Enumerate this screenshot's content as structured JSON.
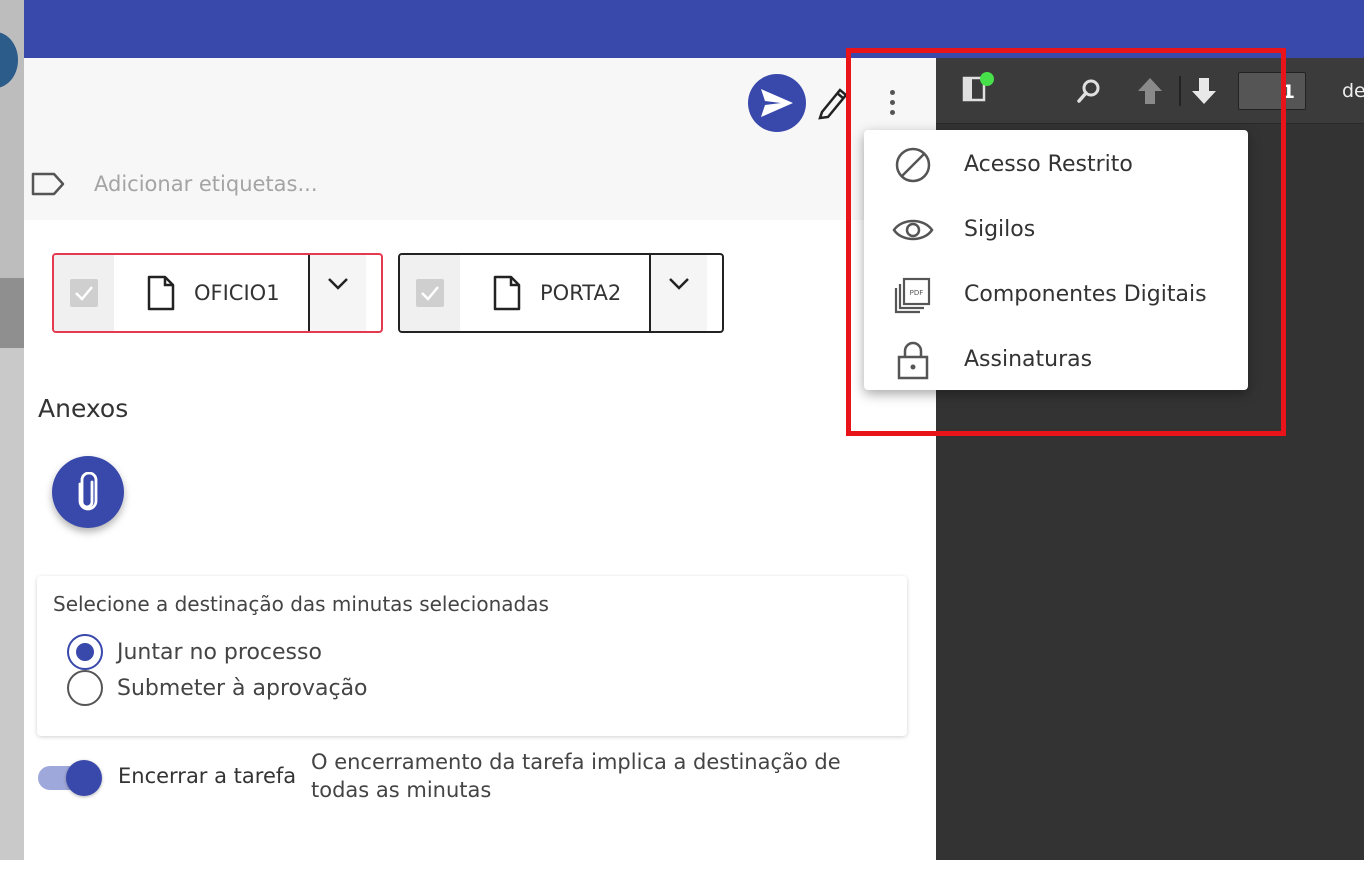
{
  "header": {
    "tags_placeholder": "Adicionar etiquetas..."
  },
  "documents": [
    {
      "name": "OFICIO1",
      "selected": true
    },
    {
      "name": "PORTA2",
      "selected": false
    }
  ],
  "anexos": {
    "title": "Anexos"
  },
  "destination": {
    "title": "Selecione a destinação das minutas selecionadas",
    "options": [
      {
        "label": "Juntar no processo",
        "checked": true
      },
      {
        "label": "Submeter à aprovação",
        "checked": false
      }
    ]
  },
  "close_task": {
    "label": "Encerrar a tarefa",
    "note": "O encerramento da tarefa implica a destinação de todas as minutas",
    "enabled": true
  },
  "pdf_viewer": {
    "page_number": "1",
    "page_of": "de"
  },
  "menu": {
    "items": [
      {
        "label": "Acesso Restrito",
        "icon": "block-icon"
      },
      {
        "label": "Sigilos",
        "icon": "eye-icon"
      },
      {
        "label": "Componentes Digitais",
        "icon": "pdf-icon"
      },
      {
        "label": "Assinaturas",
        "icon": "lock-icon"
      }
    ]
  },
  "colors": {
    "primary": "#3949ab",
    "highlight": "#e8141a",
    "pdf_background": "#333333"
  }
}
